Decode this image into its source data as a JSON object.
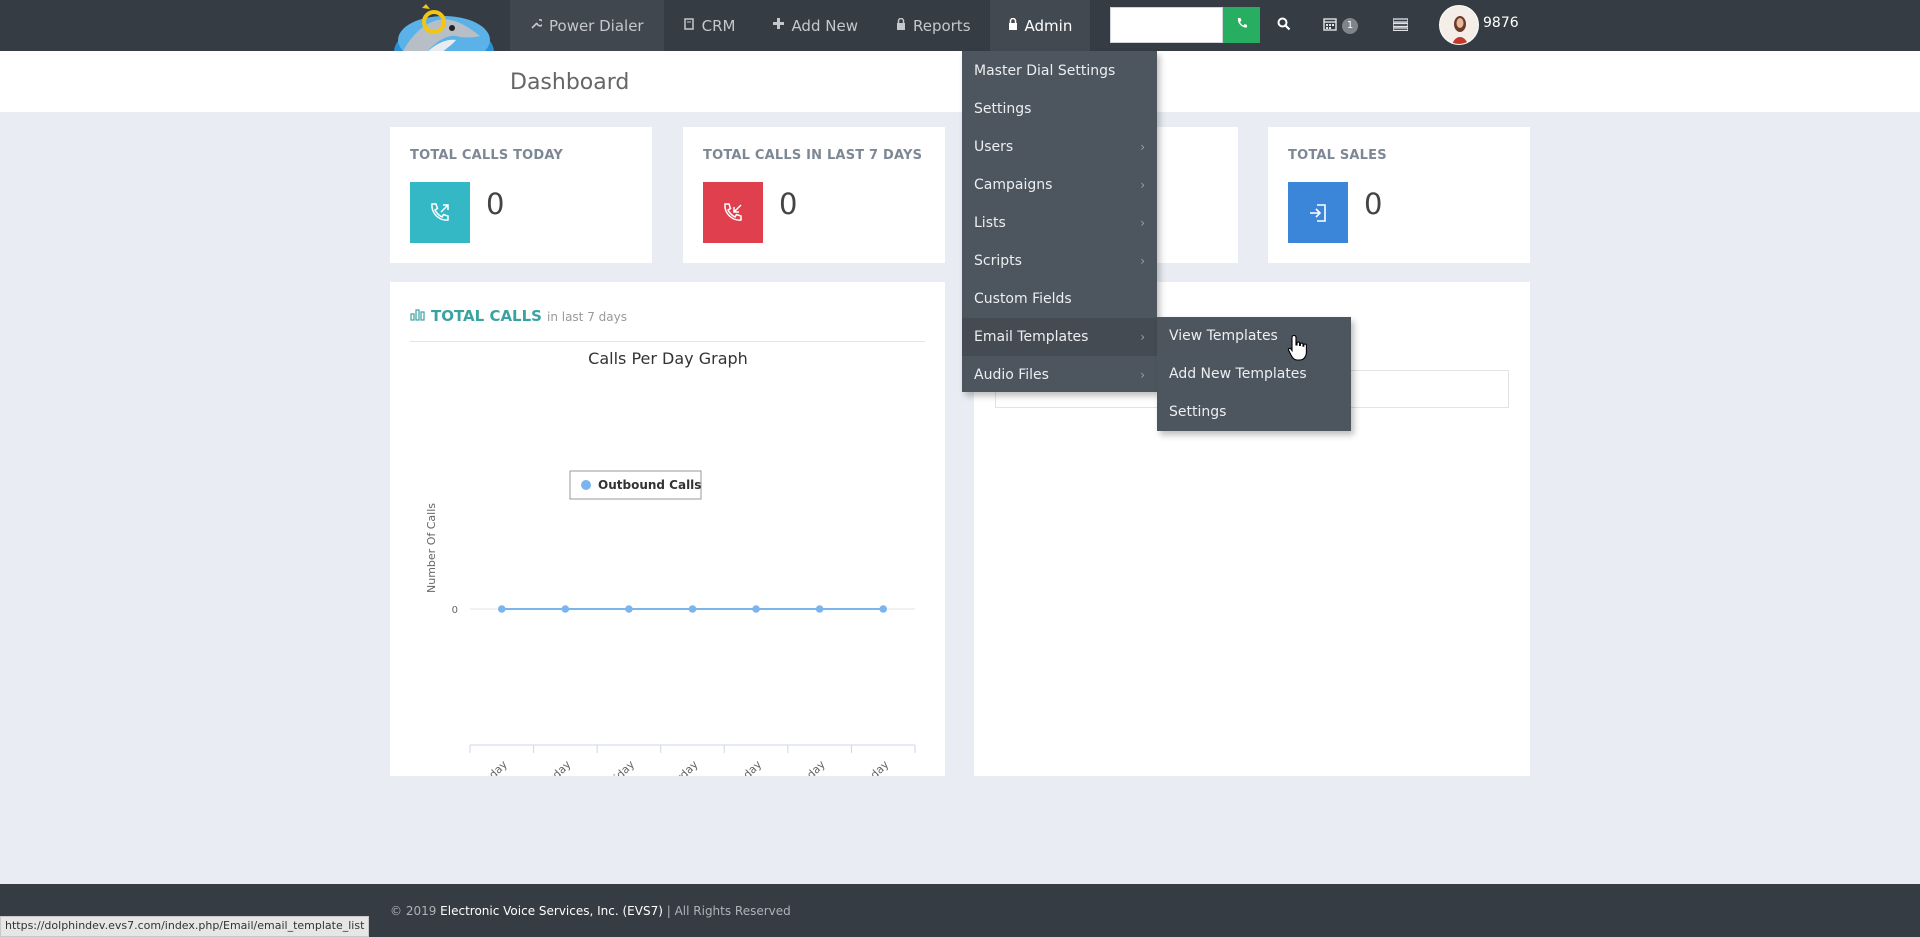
{
  "nav": {
    "items": [
      {
        "label": "Power Dialer",
        "icon": "wrench-icon"
      },
      {
        "label": "CRM",
        "icon": "book-icon"
      },
      {
        "label": "Add New",
        "icon": "plus-icon"
      },
      {
        "label": "Reports",
        "icon": "lock-icon"
      },
      {
        "label": "Admin",
        "icon": "lock-icon"
      }
    ],
    "search_value": "",
    "calendar_badge": "1",
    "user_name": "9876"
  },
  "page": {
    "title": "Dashboard"
  },
  "stats": [
    {
      "label": "TOTAL CALLS TODAY",
      "value": "0",
      "color": "#35b8c5",
      "icon": "outgoing-call-icon"
    },
    {
      "label": "TOTAL CALLS IN LAST 7 DAYS",
      "value": "0",
      "color": "#e0404d",
      "icon": "incoming-call-icon"
    },
    {
      "label": "TOTAL SALES",
      "value": "0",
      "color": "#3b86d9",
      "icon": "sign-in-icon"
    }
  ],
  "calls_panel": {
    "title": "TOTAL CALLS",
    "subtitle": "in last 7 days"
  },
  "admin_menu": {
    "items": [
      {
        "label": "Master Dial Settings",
        "has_submenu": false
      },
      {
        "label": "Settings",
        "has_submenu": false
      },
      {
        "label": "Users",
        "has_submenu": true
      },
      {
        "label": "Campaigns",
        "has_submenu": true
      },
      {
        "label": "Lists",
        "has_submenu": true
      },
      {
        "label": "Scripts",
        "has_submenu": true
      },
      {
        "label": "Custom Fields",
        "has_submenu": false
      },
      {
        "label": "Email Templates",
        "has_submenu": true
      },
      {
        "label": "Audio Files",
        "has_submenu": true
      }
    ],
    "submenu": [
      "View Templates",
      "Add New Templates",
      "Settings"
    ]
  },
  "chart_data": {
    "type": "line",
    "title": "Calls Per Day Graph",
    "xlabel": "",
    "ylabel": "Number Of Calls",
    "categories": [
      "Wednesday",
      "Thursday",
      "Friday",
      "Saturday",
      "Sunday",
      "Monday",
      "Tuesday"
    ],
    "series": [
      {
        "name": "Outbound Calls",
        "values": [
          0,
          0,
          0,
          0,
          0,
          0,
          0
        ],
        "color": "#7cb5ec"
      }
    ],
    "y_ticks": [
      "0"
    ],
    "legend": "top-center",
    "grid": false
  },
  "footer": {
    "prefix": "© 2019 ",
    "company": "Electronic Voice Services, Inc. (EVS7)",
    "suffix": " | All Rights Reserved"
  },
  "status_url": "https://dolphindev.evs7.com/index.php/Email/email_template_list"
}
